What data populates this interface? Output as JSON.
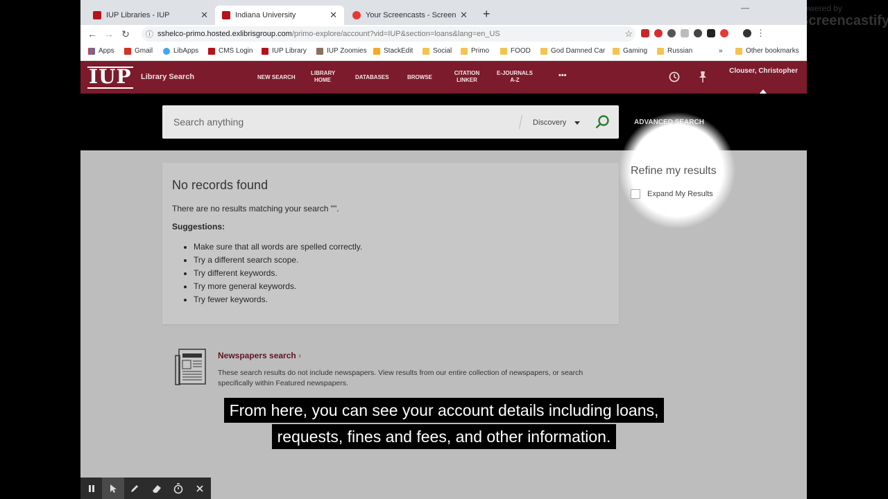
{
  "browser": {
    "tabs": [
      {
        "label": "IUP Libraries - IUP",
        "close": "✕"
      },
      {
        "label": "Indiana University",
        "close": "✕"
      },
      {
        "label": "Your Screencasts - Screencastify",
        "close": "✕"
      }
    ],
    "new_tab": "+",
    "url_host": "sshelco-primo.hosted.exlibrisgroup.com",
    "url_path": "/primo-explore/account?vid=IUP&section=loans&lang=en_US",
    "bookmarks": [
      "Apps",
      "Gmail",
      "LibApps",
      "CMS Login",
      "IUP Library",
      "IUP Zoomies",
      "StackEdit",
      "Social",
      "Primo",
      "FOOD",
      "God Damned Car",
      "Gaming",
      "Russian"
    ],
    "bookmarks_more": "»",
    "other_bookmarks": "Other bookmarks"
  },
  "site": {
    "logo": "IUP",
    "logo_sub": "Library Search",
    "nav": [
      "NEW SEARCH",
      "LIBRARY HOME",
      "DATABASES",
      "BROWSE",
      "CITATION LINKER",
      "E-JOURNALS A-Z"
    ],
    "more": "•••",
    "user": "Clouser, Christopher"
  },
  "search": {
    "placeholder": "Search anything",
    "scope": "Discovery",
    "advanced": "ADVANCED SEARCH"
  },
  "results": {
    "heading": "No records found",
    "message": "There are no results matching your search \"\".",
    "suggestions_label": "Suggestions:",
    "suggestions": [
      "Make sure that all words are spelled correctly.",
      "Try a different search scope.",
      "Try different keywords.",
      "Try more general keywords.",
      "Try fewer keywords."
    ]
  },
  "newspapers": {
    "title": "Newspapers search",
    "description": "These search results do not include newspapers. View results from our entire collection of newspapers, or search specifically within Featured newspapers."
  },
  "refine": {
    "title": "Refine my results",
    "expand": "Expand My Results"
  },
  "caption": {
    "line1": "From here, you can see your account details including loans,",
    "line2": "requests, fines and fees, and other information."
  },
  "screencastify": {
    "powered_by": "powered by",
    "name": "Screencastify"
  },
  "icons": {
    "pause": "pause-icon",
    "cursor": "cursor-icon",
    "pen": "pen-icon",
    "eraser": "eraser-icon",
    "timer": "timer-icon",
    "close": "close-icon"
  },
  "colors": {
    "brand": "#7b1b2b",
    "go": "#2e7d32"
  }
}
